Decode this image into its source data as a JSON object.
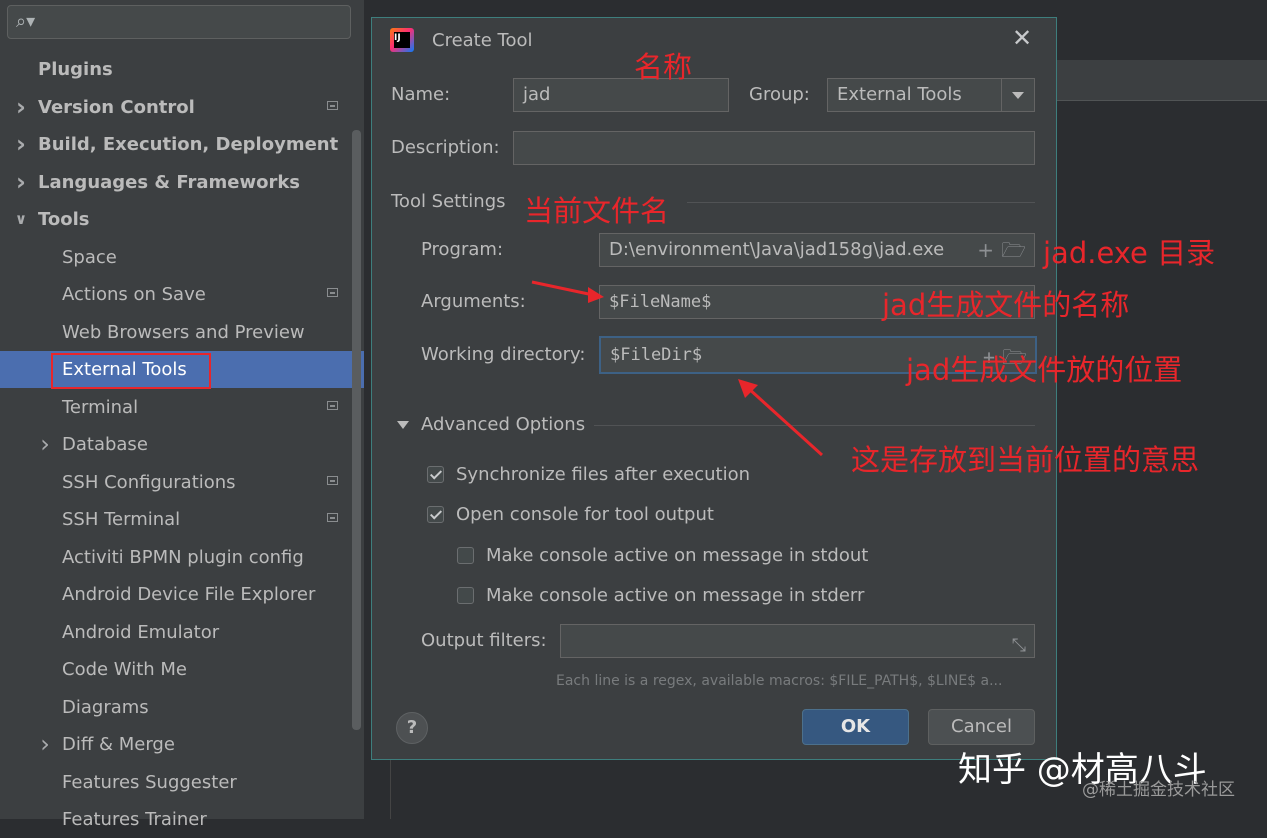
{
  "sidebar": {
    "search_placeholder": "",
    "items": [
      {
        "label": "Plugins",
        "bold": true,
        "chevron": "",
        "marker": false
      },
      {
        "label": "Version Control",
        "bold": true,
        "chevron": ">",
        "marker": true
      },
      {
        "label": "Build, Execution, Deployment",
        "bold": true,
        "chevron": ">",
        "marker": false
      },
      {
        "label": "Languages & Frameworks",
        "bold": true,
        "chevron": ">",
        "marker": false
      },
      {
        "label": "Tools",
        "bold": true,
        "chevron": "v",
        "marker": false
      },
      {
        "label": "Space",
        "bold": false,
        "chevron": "",
        "marker": false
      },
      {
        "label": "Actions on Save",
        "bold": false,
        "chevron": "",
        "marker": true
      },
      {
        "label": "Web Browsers and Preview",
        "bold": false,
        "chevron": "",
        "marker": false
      },
      {
        "label": "External Tools",
        "bold": false,
        "chevron": "",
        "marker": false,
        "selected": true
      },
      {
        "label": "Terminal",
        "bold": false,
        "chevron": "",
        "marker": true
      },
      {
        "label": "Database",
        "bold": false,
        "chevron": ">",
        "marker": false
      },
      {
        "label": "SSH Configurations",
        "bold": false,
        "chevron": "",
        "marker": true
      },
      {
        "label": "SSH Terminal",
        "bold": false,
        "chevron": "",
        "marker": true
      },
      {
        "label": "Activiti BPMN plugin config",
        "bold": false,
        "chevron": "",
        "marker": false
      },
      {
        "label": "Android Device File Explorer",
        "bold": false,
        "chevron": "",
        "marker": false
      },
      {
        "label": "Android Emulator",
        "bold": false,
        "chevron": "",
        "marker": false
      },
      {
        "label": "Code With Me",
        "bold": false,
        "chevron": "",
        "marker": false
      },
      {
        "label": "Diagrams",
        "bold": false,
        "chevron": "",
        "marker": false
      },
      {
        "label": "Diff & Merge",
        "bold": false,
        "chevron": ">",
        "marker": false
      },
      {
        "label": "Features Suggester",
        "bold": false,
        "chevron": "",
        "marker": false
      },
      {
        "label": "Features Trainer",
        "bold": false,
        "chevron": "",
        "marker": false
      }
    ]
  },
  "dialog": {
    "title": "Create Tool",
    "app_icon": "intellij-icon",
    "name_label": "Name:",
    "name_value": "jad",
    "group_label": "Group:",
    "group_value": "External Tools",
    "description_label": "Description:",
    "description_value": "",
    "tool_settings_label": "Tool Settings",
    "program_label": "Program:",
    "program_value": "D:\\environment\\Java\\jad158g\\jad.exe",
    "arguments_label": "Arguments:",
    "arguments_value": "$FileName$",
    "working_dir_label": "Working directory:",
    "working_dir_value": "$FileDir$",
    "advanced_label": "Advanced Options",
    "sync_label": "Synchronize files after execution",
    "sync_checked": true,
    "console_label": "Open console for tool output",
    "console_checked": true,
    "stdout_label": "Make console active on message in stdout",
    "stdout_checked": false,
    "stderr_label": "Make console active on message in stderr",
    "stderr_checked": false,
    "output_filters_label": "Output filters:",
    "output_filters_value": "",
    "hint": "Each line is a regex, available macros: $FILE_PATH$, $LINE$ a...",
    "help_label": "?",
    "ok_label": "OK",
    "cancel_label": "Cancel"
  },
  "annotations": {
    "name_note": "名称",
    "tool_settings_note": "当前文件名",
    "program_note": "jad.exe 目录",
    "arguments_note": "jad生成文件的名称",
    "working_dir_note": "jad生成文件放的位置",
    "current_location_note": "这是存放到当前位置的意思",
    "color": "#e8262b"
  },
  "watermark": {
    "text": "知乎 @材高八斗",
    "subtext": "@稀土掘金技术社区"
  }
}
